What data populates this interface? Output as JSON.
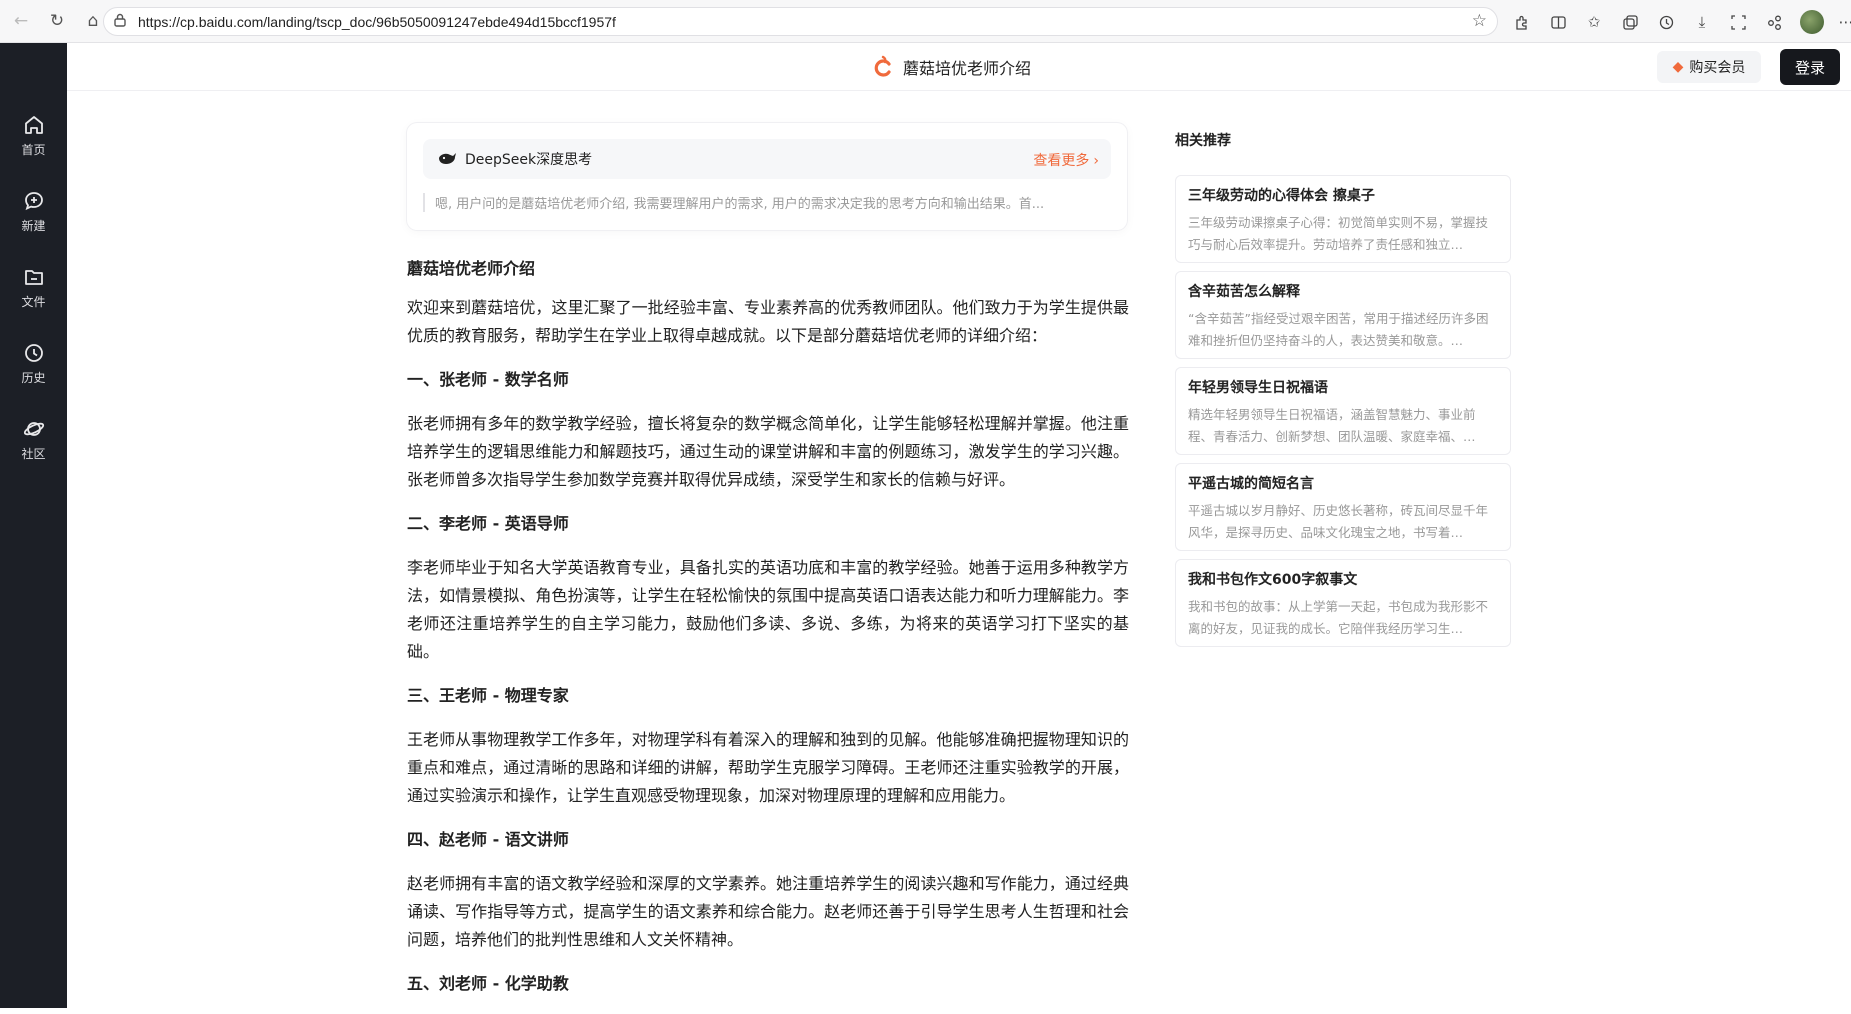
{
  "browser": {
    "url": "https://cp.baidu.com/landing/tscp_doc/96b5050091247ebde494d15bccf1957f",
    "extension_icons": [
      "extensions-icon",
      "split-view-icon",
      "favorites-icon",
      "collections-icon",
      "history-icon",
      "downloads-icon",
      "screenshot-icon",
      "share-icon"
    ]
  },
  "sidebar": {
    "items": [
      {
        "label": "首页",
        "icon": "home-icon"
      },
      {
        "label": "新建",
        "icon": "new-chat-icon"
      },
      {
        "label": "文件",
        "icon": "folder-icon"
      },
      {
        "label": "历史",
        "icon": "clock-icon"
      },
      {
        "label": "社区",
        "icon": "planet-icon"
      }
    ]
  },
  "header": {
    "title": "蘑菇培优老师介绍",
    "vip_label": "购买会员",
    "login_label": "登录"
  },
  "deepseek": {
    "title": "DeepSeek深度思考",
    "more_label": "查看更多",
    "excerpt": "嗯, 用户问的是蘑菇培优老师介绍, 我需要理解用户的需求, 用户的需求决定我的思考方向和输出结果。首..."
  },
  "article": {
    "title": "蘑菇培优老师介绍",
    "intro": "欢迎来到蘑菇培优，这里汇聚了一批经验丰富、专业素养高的优秀教师团队。他们致力于为学生提供最优质的教育服务，帮助学生在学业上取得卓越成就。以下是部分蘑菇培优老师的详细介绍：",
    "sections": [
      {
        "heading": "一、张老师 - 数学名师",
        "body": "张老师拥有多年的数学教学经验，擅长将复杂的数学概念简单化，让学生能够轻松理解并掌握。他注重培养学生的逻辑思维能力和解题技巧，通过生动的课堂讲解和丰富的例题练习，激发学生的学习兴趣。张老师曾多次指导学生参加数学竞赛并取得优异成绩，深受学生和家长的信赖与好评。"
      },
      {
        "heading": "二、李老师 - 英语导师",
        "body": "李老师毕业于知名大学英语教育专业，具备扎实的英语功底和丰富的教学经验。她善于运用多种教学方法，如情景模拟、角色扮演等，让学生在轻松愉快的氛围中提高英语口语表达能力和听力理解能力。李老师还注重培养学生的自主学习能力，鼓励他们多读、多说、多练，为将来的英语学习打下坚实的基础。"
      },
      {
        "heading": "三、王老师 - 物理专家",
        "body": "王老师从事物理教学工作多年，对物理学科有着深入的理解和独到的见解。他能够准确把握物理知识的重点和难点，通过清晰的思路和详细的讲解，帮助学生克服学习障碍。王老师还注重实验教学的开展，通过实验演示和操作，让学生直观感受物理现象，加深对物理原理的理解和应用能力。"
      },
      {
        "heading": "四、赵老师 - 语文讲师",
        "body": "赵老师拥有丰富的语文教学经验和深厚的文学素养。她注重培养学生的阅读兴趣和写作能力，通过经典诵读、写作指导等方式，提高学生的语文素养和综合能力。赵老师还善于引导学生思考人生哲理和社会问题，培养他们的批判性思维和人文关怀精神。"
      },
      {
        "heading": "五、刘老师 - 化学助教",
        "body": ""
      }
    ]
  },
  "recommendations": {
    "title": "相关推荐",
    "items": [
      {
        "title": "三年级劳动的心得体会 擦桌子",
        "snippet": "三年级劳动课擦桌子心得：初觉简单实则不易，掌握技巧与耐心后效率提升。劳动培养了责任感和独立…"
      },
      {
        "title": "含辛茹苦怎么解释",
        "snippet": "“含辛茹苦”指经受过艰辛困苦，常用于描述经历许多困难和挫折但仍坚持奋斗的人，表达赞美和敬意。…"
      },
      {
        "title": "年轻男领导生日祝福语",
        "snippet": "精选年轻男领导生日祝福语，涵盖智慧魅力、事业前程、青春活力、创新梦想、团队温暖、家庭幸福、…"
      },
      {
        "title": "平遥古城的简短名言",
        "snippet": "平遥古城以岁月静好、历史悠长著称，砖瓦间尽显千年风华，是探寻历史、品味文化瑰宝之地，书写着…"
      },
      {
        "title": "我和书包作文600字叙事文",
        "snippet": "我和书包的故事：从上学第一天起，书包成为我形影不离的好友，见证我的成长。它陪伴我经历学习生…"
      }
    ]
  }
}
